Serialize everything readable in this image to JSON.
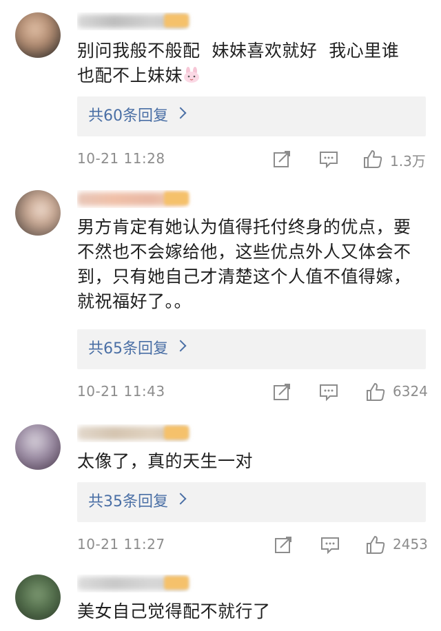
{
  "comments": [
    {
      "text_line1": "别问我般不般配  妹妹喜欢就好  我心里谁",
      "text_line2": "也配不上妹妹",
      "emoji_icon": "bunny-emoji-icon",
      "replies_label": "共60条回复",
      "timestamp": "10-21 11:28",
      "likes": "1.3万"
    },
    {
      "text": "男方肯定有她认为值得托付终身的优点，要\n不然也不会嫁给他，这些优点外人又体会不\n到，只有她自己才清楚这个人值不值得嫁，\n就祝福好了。。",
      "replies_label": "共65条回复",
      "timestamp": "10-21 11:43",
      "likes": "6324"
    },
    {
      "text": "太像了，真的天生一对",
      "replies_label": "共35条回复",
      "timestamp": "10-21 11:27",
      "likes": "2453"
    },
    {
      "text": "美女自己觉得配不就行了"
    }
  ],
  "icons": {
    "share": "share-icon",
    "comment": "comment-icon",
    "like": "thumbs-up-icon",
    "reply_arrow": "chevron-right-icon"
  },
  "colors": {
    "link_blue": "#4a6fa5",
    "meta_gray": "#8c8c8c",
    "reply_bg": "#f2f2f2",
    "badge_gold": "#f5c16b"
  }
}
